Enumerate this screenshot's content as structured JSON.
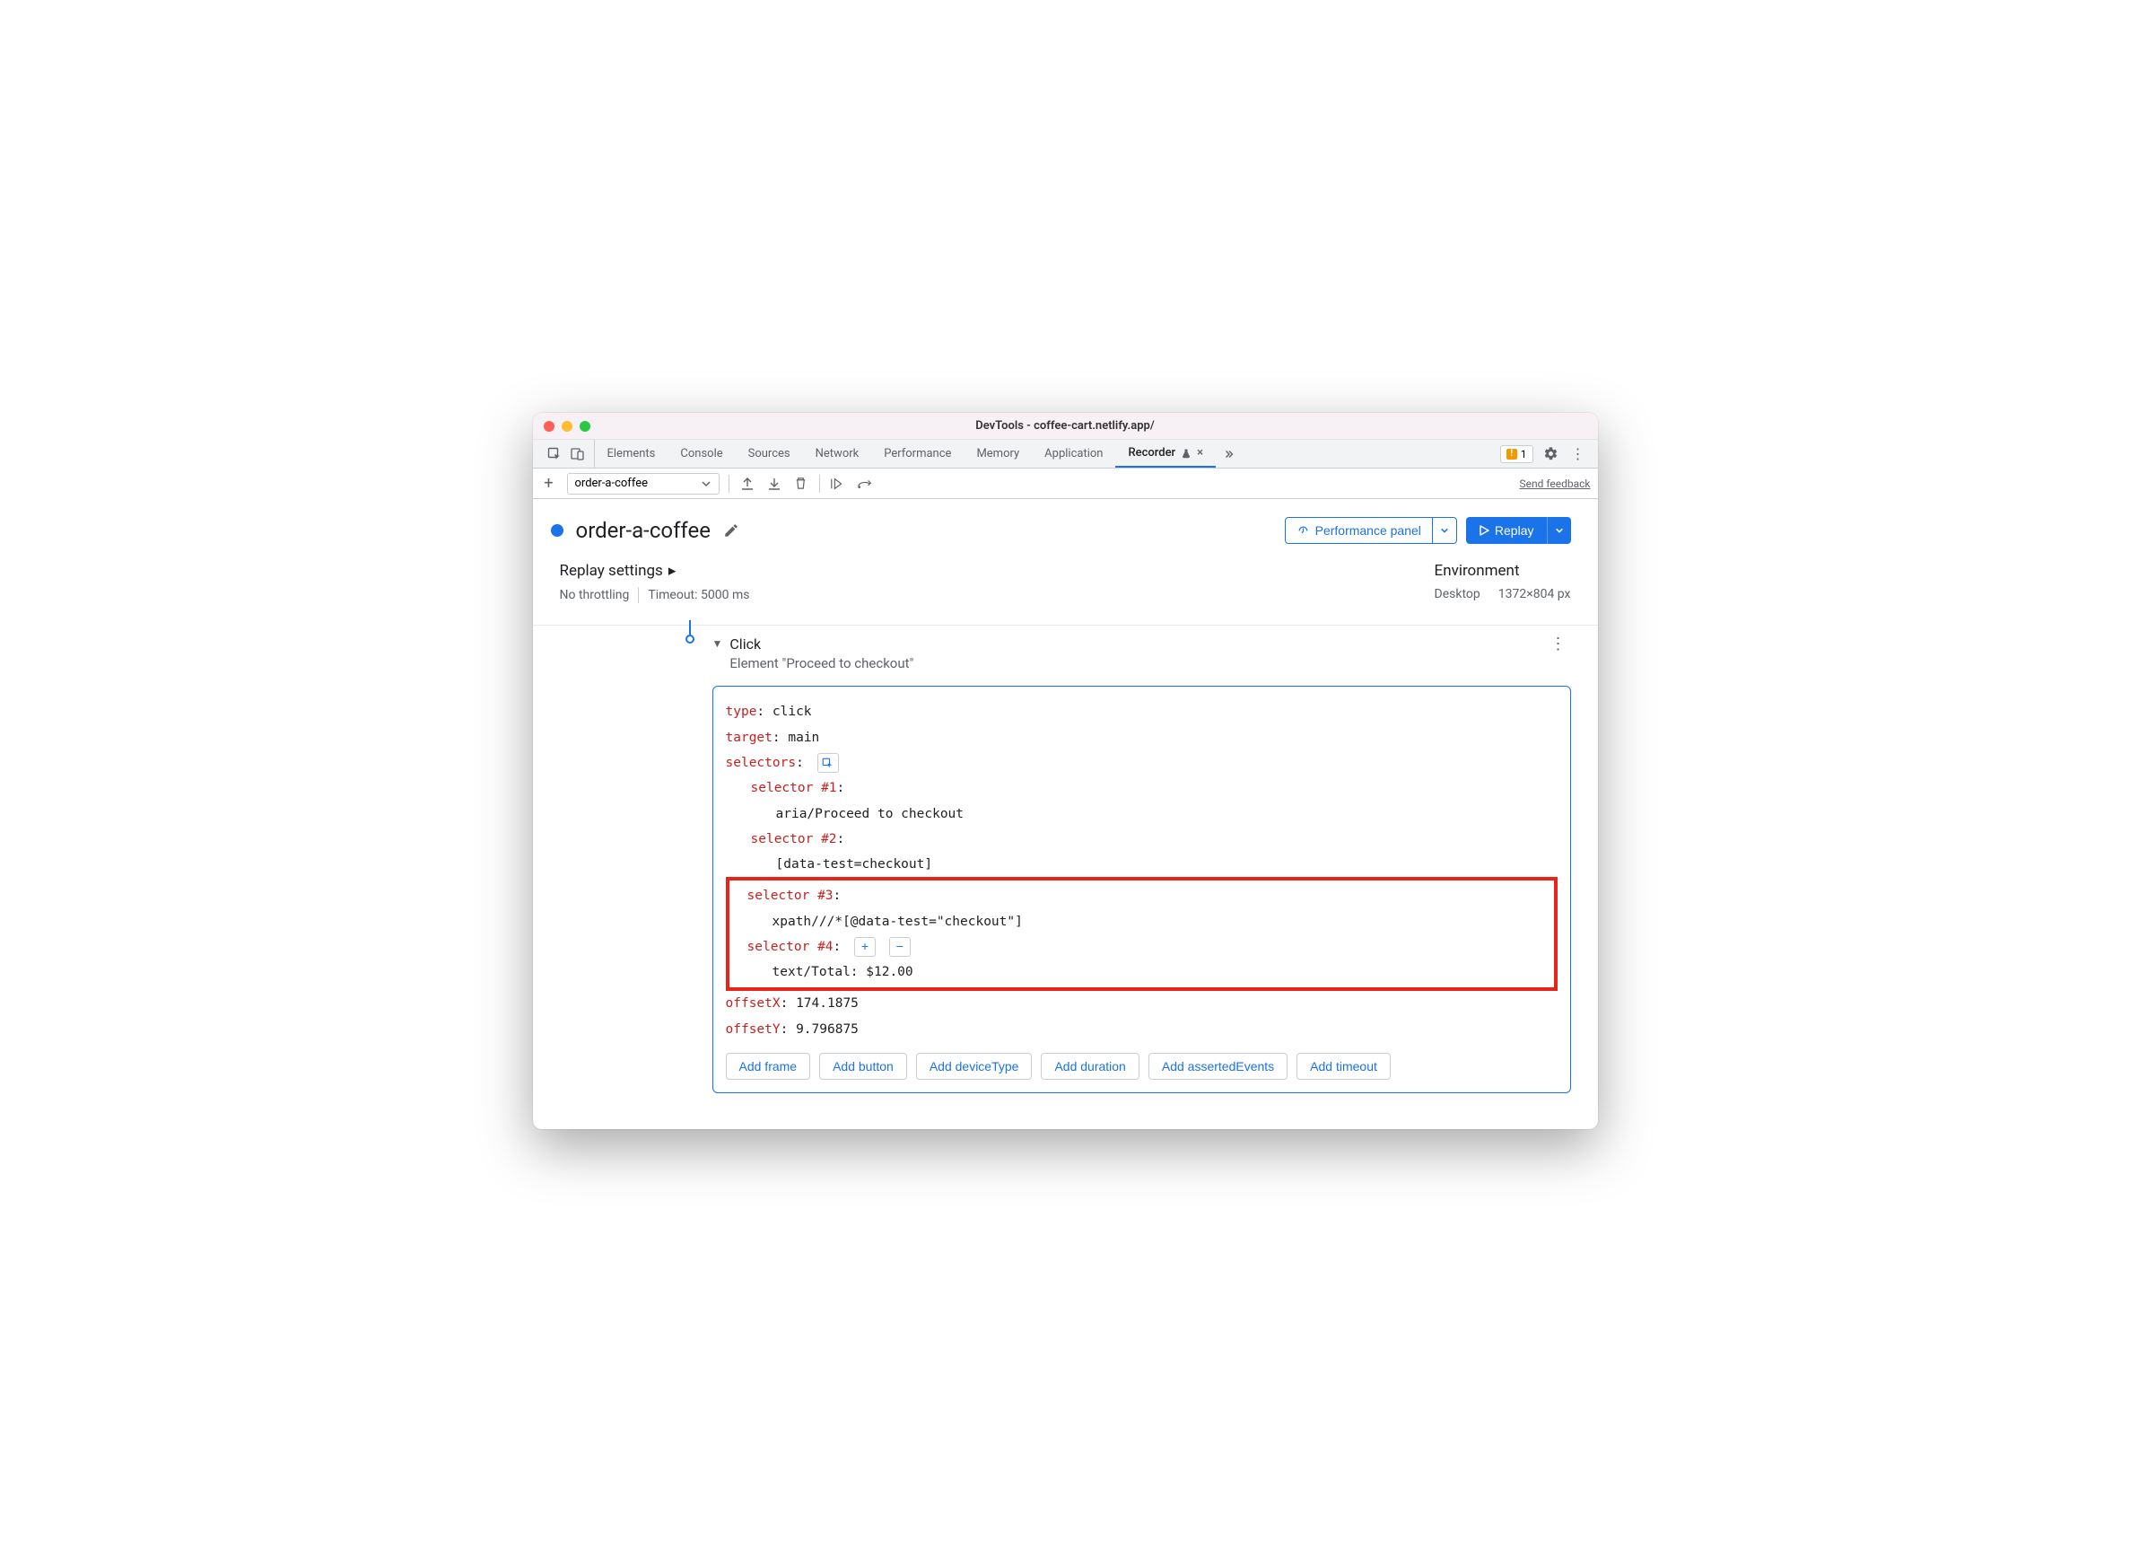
{
  "window": {
    "title": "DevTools - coffee-cart.netlify.app/"
  },
  "tabs": {
    "items": [
      "Elements",
      "Console",
      "Sources",
      "Network",
      "Performance",
      "Memory",
      "Application",
      "Recorder"
    ],
    "active_index": 7,
    "issues_count": "1"
  },
  "toolbar": {
    "recording_name": "order-a-coffee",
    "send_feedback": "Send feedback"
  },
  "header": {
    "title": "order-a-coffee",
    "performance_btn": "Performance panel",
    "replay_btn": "Replay"
  },
  "settings": {
    "replay_label": "Replay settings",
    "throttling": "No throttling",
    "timeout": "Timeout: 5000 ms",
    "environment_label": "Environment",
    "device": "Desktop",
    "dimensions": "1372×804 px"
  },
  "step": {
    "name": "Click",
    "desc": "Element \"Proceed to checkout\"",
    "type_key": "type",
    "type_val": "click",
    "target_key": "target",
    "target_val": "main",
    "selectors_key": "selectors",
    "sel1_key": "selector #1",
    "sel1_val": "aria/Proceed to checkout",
    "sel2_key": "selector #2",
    "sel2_val": "[data-test=checkout]",
    "sel3_key": "selector #3",
    "sel3_val": "xpath///*[@data-test=\"checkout\"]",
    "sel4_key": "selector #4",
    "sel4_val": "text/Total: $12.00",
    "offsetx_key": "offsetX",
    "offsetx_val": "174.1875",
    "offsety_key": "offsetY",
    "offsety_val": "9.796875"
  },
  "add_buttons": [
    "Add frame",
    "Add button",
    "Add deviceType",
    "Add duration",
    "Add assertedEvents",
    "Add timeout"
  ]
}
